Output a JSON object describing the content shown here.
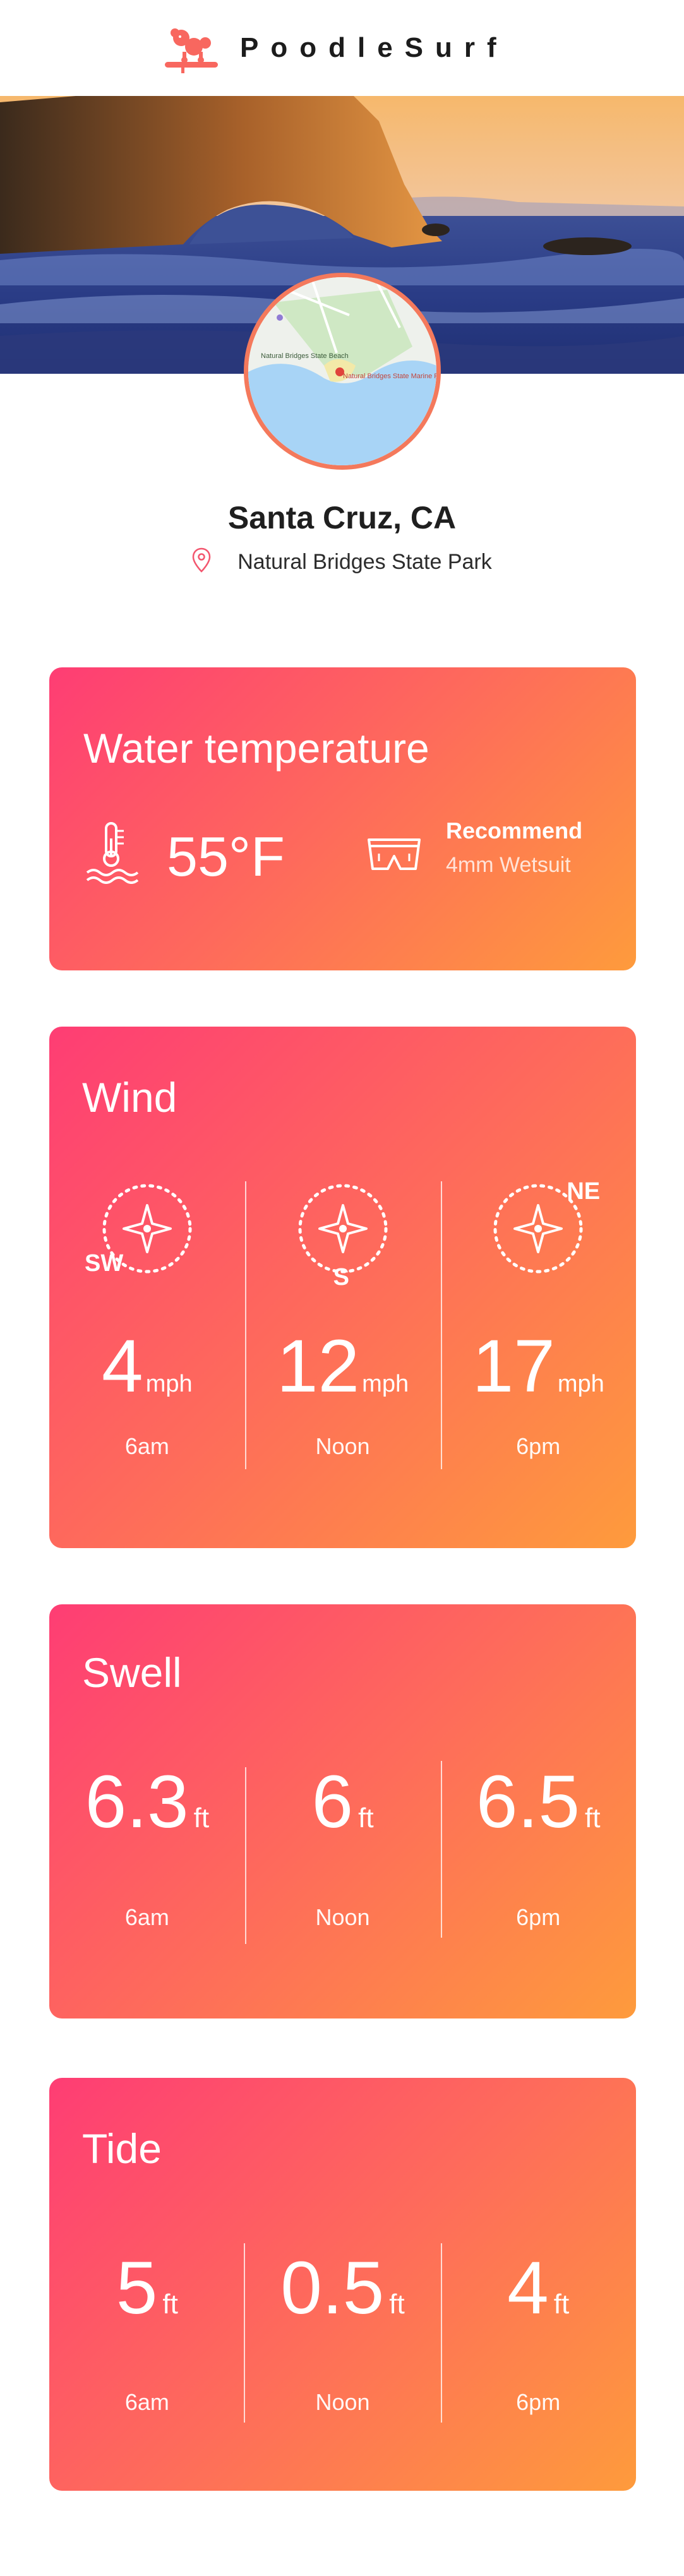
{
  "app": {
    "brand": "PoodleSurf",
    "logo_icon": "poodle-surfboard-icon"
  },
  "location": {
    "name": "Santa Cruz, CA",
    "spot": "Natural Bridges State Park",
    "pin_icon": "map-pin-icon"
  },
  "map": {
    "labels": [
      "Natural Bridges State Beach",
      "Natural Bridges State Marine Reserve"
    ]
  },
  "water": {
    "title": "Water temperature",
    "temperature": "55°F",
    "recommend_label": "Recommend",
    "recommend_value": "4mm Wetsuit",
    "temp_icon": "thermometer-water-icon",
    "gear_icon": "wetsuit-shorts-icon"
  },
  "wind": {
    "title": "Wind",
    "entries": [
      {
        "direction": "SW",
        "value": "4",
        "unit": "mph",
        "time": "6am"
      },
      {
        "direction": "S",
        "value": "12",
        "unit": "mph",
        "time": "Noon"
      },
      {
        "direction": "NE",
        "value": "17",
        "unit": "mph",
        "time": "6pm"
      }
    ]
  },
  "swell": {
    "title": "Swell",
    "entries": [
      {
        "value": "6.3",
        "unit": "ft",
        "time": "6am"
      },
      {
        "value": "6",
        "unit": "ft",
        "time": "Noon"
      },
      {
        "value": "6.5",
        "unit": "ft",
        "time": "6pm"
      }
    ]
  },
  "tide": {
    "title": "Tide",
    "entries": [
      {
        "value": "5",
        "unit": "ft",
        "time": "6am"
      },
      {
        "value": "0.5",
        "unit": "ft",
        "time": "Noon"
      },
      {
        "value": "4",
        "unit": "ft",
        "time": "6pm"
      }
    ]
  },
  "colors": {
    "gradient_start": "#fe3d74",
    "gradient_mid": "#fe6b5b",
    "gradient_end": "#fe9b3c",
    "accent": "#f4795c"
  }
}
